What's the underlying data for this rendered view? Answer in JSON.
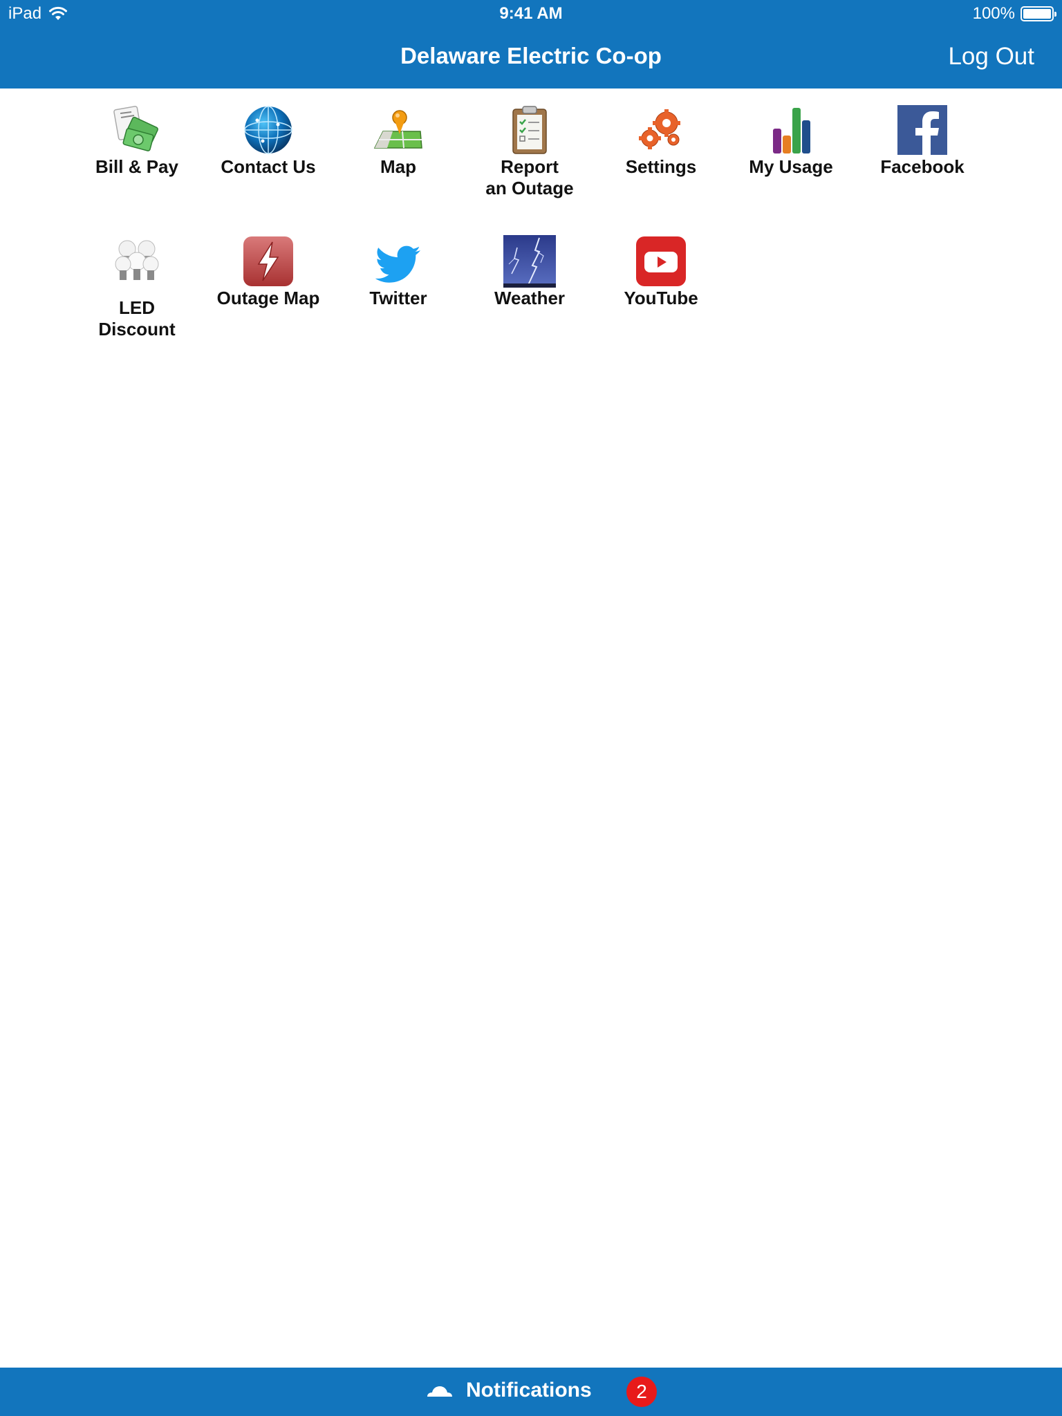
{
  "status_bar": {
    "device": "iPad",
    "time": "9:41 AM",
    "battery": "100%",
    "battery_level": 1.0
  },
  "nav": {
    "title": "Delaware Electric Co-op",
    "logout_label": "Log Out"
  },
  "tiles": [
    {
      "label": "Bill & Pay",
      "icon": "bill-pay-icon"
    },
    {
      "label": "Contact Us",
      "icon": "globe-icon"
    },
    {
      "label": "Map",
      "icon": "map-pin-icon"
    },
    {
      "label": "Report\nan Outage",
      "icon": "clipboard-icon"
    },
    {
      "label": "Settings",
      "icon": "gears-icon"
    },
    {
      "label": "My Usage",
      "icon": "bar-chart-icon"
    },
    {
      "label": "Facebook",
      "icon": "facebook-icon"
    },
    {
      "label": "LED\nDiscount",
      "icon": "light-bulbs-icon"
    },
    {
      "label": "Outage Map",
      "icon": "lightning-icon"
    },
    {
      "label": "Twitter",
      "icon": "twitter-bird-icon"
    },
    {
      "label": "Weather",
      "icon": "storm-icon"
    },
    {
      "label": "YouTube",
      "icon": "youtube-icon"
    }
  ],
  "notifications": {
    "label": "Notifications",
    "count": "2",
    "icon": "cloud-icon"
  },
  "colors": {
    "primary": "#1275bd",
    "badge": "#e81a1a"
  }
}
